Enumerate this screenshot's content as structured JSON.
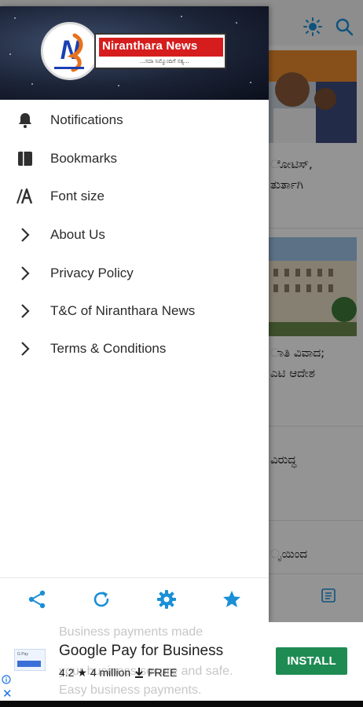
{
  "app": {
    "logo_name": "Niranthara News",
    "logo_tagline": "...ಸದಾ ನಿಮ್ಮೊಂದಿಗೆ ಸತ್ಯ..."
  },
  "drawer": {
    "items": [
      {
        "label": "Notifications",
        "icon": "bell-icon"
      },
      {
        "label": "Bookmarks",
        "icon": "bookmark-book-icon"
      },
      {
        "label": "Font size",
        "icon": "font-size-icon"
      },
      {
        "label": "About Us",
        "icon": "chevron-right-icon"
      },
      {
        "label": "Privacy Policy",
        "icon": "chevron-right-icon"
      },
      {
        "label": "T&C of Niranthara News",
        "icon": "chevron-right-icon"
      },
      {
        "label": "Terms & Conditions",
        "icon": "chevron-right-icon"
      }
    ],
    "footer_icons": [
      "share-icon",
      "refresh-icon",
      "settings-icon",
      "star-icon"
    ]
  },
  "background": {
    "topbar_icons": [
      "brightness-icon",
      "search-icon"
    ],
    "snippets": [
      "ೋಟಿಸ್,",
      "ತುರ್ತಾಗಿ",
      "ಾತಿ ವಿವಾದ;",
      "ಎಟಿ ಆದೇಶ",
      "ವಿರುದ್ಧ",
      "ೃಯಿಂದ"
    ]
  },
  "ad": {
    "ghost_line_1": "Business payments made",
    "ghost_line_2": "your business secure and safe.",
    "ghost_line_3": "Easy business payments.",
    "title": "Google Pay for Business",
    "rating": "4.2",
    "installs": "4 million",
    "price": "FREE",
    "install_label": "INSTALL",
    "thumb_text": "G Pay"
  },
  "colors": {
    "accent": "#1a8fd6",
    "install_button": "#1e8b53",
    "logo_red": "#d61d1d"
  }
}
